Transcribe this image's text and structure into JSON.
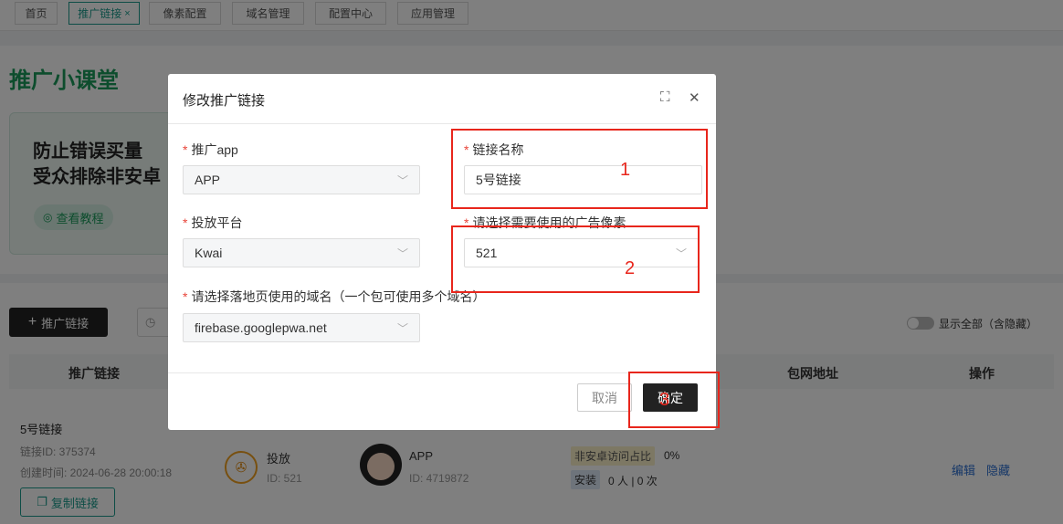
{
  "tabs": [
    {
      "label": "首页"
    },
    {
      "label": "推广链接",
      "close": "×"
    },
    {
      "label": "像素配置"
    },
    {
      "label": "域名管理"
    },
    {
      "label": "配置中心"
    },
    {
      "label": "应用管理"
    }
  ],
  "page": {
    "title": "推广小课堂",
    "banner_line1": "防止错误买量",
    "banner_line2": "受众排除非安卓",
    "tutorial_label": "查看教程",
    "tutorial_icon": "location-pin-icon"
  },
  "toolbar": {
    "add_label": "推广链接",
    "add_icon": "+",
    "date_icon": "clock-icon",
    "show_all_label": "显示全部（含隐藏）"
  },
  "table": {
    "headers": {
      "link": "推广链接",
      "package_url": "包网地址",
      "actions": "操作"
    },
    "row": {
      "name": "5号链接",
      "link_id": "链接ID: 375374",
      "created": "创建时间: 2024-06-28 20:00:18",
      "copy_label": "复制链接",
      "ad_label": "投放",
      "ad_id": "ID: 521",
      "app_name": "APP",
      "app_id": "ID: 4719872",
      "non_android_label": "非安卓访问占比",
      "non_android_value": "0%",
      "install_label": "安装",
      "install_value": "0 人 | 0 次",
      "edit": "编辑",
      "hide": "隐藏"
    }
  },
  "modal": {
    "title": "修改推广链接",
    "fields": {
      "app_label": "推广app",
      "app_value": "APP",
      "name_label": "链接名称",
      "name_value": "5号链接",
      "platform_label": "投放平台",
      "platform_value": "Kwai",
      "pixel_label": "请选择需要使用的广告像素",
      "pixel_value": "521",
      "domain_label": "请选择落地页使用的域名（一个包可使用多个域名）",
      "domain_value": "firebase.googlepwa.net"
    },
    "required_mark": "*",
    "cancel_label": "取消",
    "confirm_label": "确定"
  },
  "annotations": {
    "n1": "1",
    "n2": "2",
    "n3": "3"
  }
}
